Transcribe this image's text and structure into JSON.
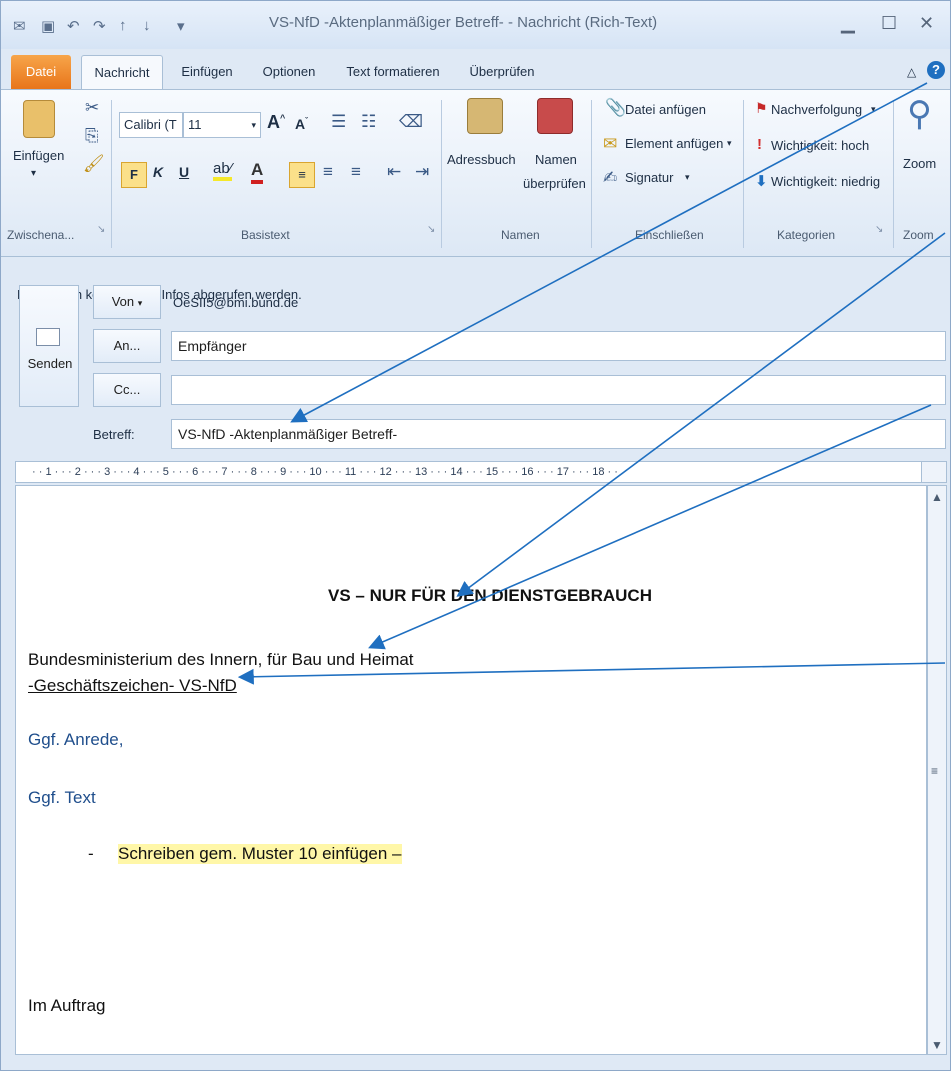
{
  "window": {
    "title": "VS-NfD -Aktenplanmäßiger Betreff- - Nachricht (Rich-Text)"
  },
  "tabs": [
    "Datei",
    "Nachricht",
    "Einfügen",
    "Optionen",
    "Text formatieren",
    "Überprüfen"
  ],
  "ribbon": {
    "clipboard": {
      "paste_label": "Einfügen",
      "group_label": "Zwischena..."
    },
    "basic_text": {
      "font_name": "Calibri (T",
      "font_size": "11",
      "bold": "F",
      "italic": "K",
      "underline": "U",
      "group_label": "Basistext"
    },
    "names": {
      "address_book": "Adressbuch",
      "check_names_1": "Namen",
      "check_names_2": "überprüfen",
      "group_label": "Namen"
    },
    "include": {
      "attach_file": "Datei anfügen",
      "attach_item": "Element anfügen",
      "signature": "Signatur",
      "group_label": "Einschließen"
    },
    "tags": {
      "follow_up": "Nachverfolgung",
      "high": "Wichtigkeit: hoch",
      "low": "Wichtigkeit: niedrig",
      "group_label": "Kategorien"
    },
    "zoom": {
      "label": "Zoom",
      "group_label": "Zoom"
    }
  },
  "header": {
    "info_message": "Es konnten keine E-Mail-Infos abgerufen werden.",
    "send_label": "Senden",
    "from_label": "Von",
    "from_value": "OeSII5@bmi.bund.de",
    "to_label": "An...",
    "to_value": "Empfänger",
    "cc_label": "Cc...",
    "cc_value": "",
    "subject_label": "Betreff:",
    "subject_value": "VS-NfD -Aktenplanmäßiger Betreff-"
  },
  "ruler": {
    "text": "· · 1 · · · 2 · · · 3 · · · 4 · · · 5 · · · 6 · · · 7 · · · 8 · · · 9 · · · 10 · · · 11 · · · 12 · · · 13 · · · 14 · · · 15 · · · 16 · · · 17 · · · 18 · ·"
  },
  "body": {
    "classification": "VS – NUR FÜR DEN DIENSTGEBRAUCH",
    "ministry": "Bundesministerium des Innern, für Bau und Heimat",
    "reference": "-Geschäftszeichen-  VS-NfD",
    "salutation": "Ggf. Anrede,",
    "text": "Ggf. Text",
    "bullet_dash": "-",
    "bullet_text": "Schreiben gem.  Muster 10 einfügen –",
    "closing": "Im Auftrag"
  },
  "colors": {
    "accent_blue": "#1f6fc0",
    "file_tab": "#e8751a",
    "highlight": "#fff7a8"
  }
}
